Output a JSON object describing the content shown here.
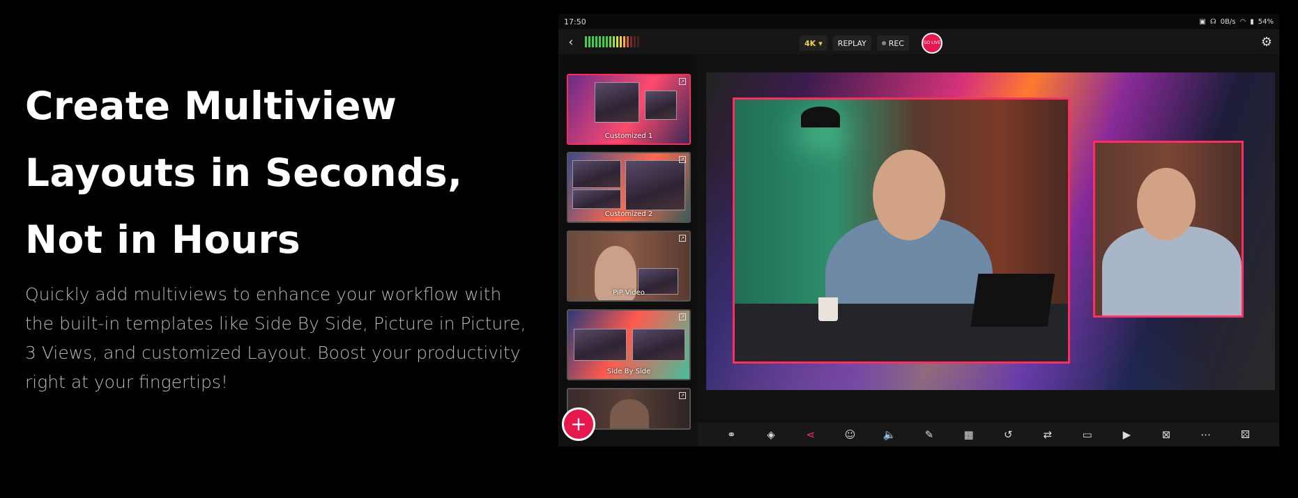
{
  "hero": {
    "title_lines": [
      "Create Multiview",
      "Layouts in Seconds,",
      "Not in Hours"
    ],
    "subtitle": "Quickly add multiviews to enhance your workflow with the built-in templates like Side By Side, Picture in Picture, 3 Views, and customized Layout. Boost your productivity right at your fingertips!"
  },
  "device": {
    "status": {
      "time": "17:50",
      "net": "0B/s",
      "battery": "54%"
    },
    "topbar": {
      "quality": "4K",
      "replay": "REPLAY",
      "rec": "REC",
      "go_live": "GO LIVE"
    },
    "layouts": [
      {
        "label": "Customized 1",
        "active": true
      },
      {
        "label": "Customized 2",
        "active": false
      },
      {
        "label": "PiP Video",
        "active": false
      },
      {
        "label": "Side By Side",
        "active": false
      },
      {
        "label": "",
        "active": false
      }
    ],
    "fab": "+",
    "toolbar": [
      {
        "name": "scenes-icon",
        "glyph": "⚭"
      },
      {
        "name": "layers-icon",
        "glyph": "◈"
      },
      {
        "name": "multiview-icon",
        "glyph": "⋖",
        "active": true
      },
      {
        "name": "guests-icon",
        "glyph": "☺"
      },
      {
        "name": "audio-icon",
        "glyph": "🔈"
      },
      {
        "name": "edit-icon",
        "glyph": "✎"
      },
      {
        "name": "score-icon",
        "glyph": "▦"
      },
      {
        "name": "replay-icon",
        "glyph": "↺"
      },
      {
        "name": "switch-icon",
        "glyph": "⇄"
      },
      {
        "name": "comments-icon",
        "glyph": "▭"
      },
      {
        "name": "camera-icon",
        "glyph": "▶"
      },
      {
        "name": "layout-icon",
        "glyph": "⊠"
      },
      {
        "name": "more-icon",
        "glyph": "⋯"
      },
      {
        "name": "dice-icon",
        "glyph": "⚄"
      }
    ],
    "colors": {
      "accent": "#ff2d5e",
      "live": "#e8174d"
    }
  }
}
